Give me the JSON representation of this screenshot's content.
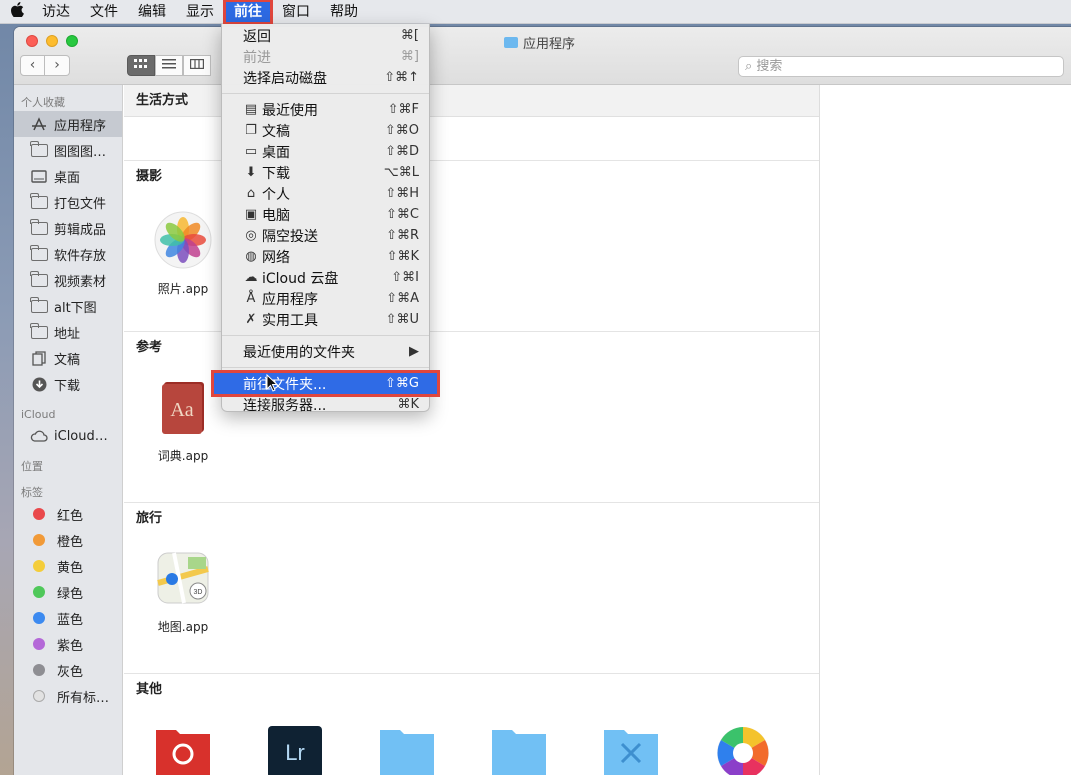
{
  "menubar": {
    "apple": "",
    "items": [
      "访达",
      "文件",
      "编辑",
      "显示",
      "前往",
      "窗口",
      "帮助"
    ]
  },
  "window": {
    "title": "应用程序",
    "search_placeholder": "搜索",
    "nav_back": "‹",
    "nav_forward": "›"
  },
  "sidebar": {
    "favorites_header": "个人收藏",
    "favorites": [
      "应用程序",
      "图图图…",
      "桌面",
      "打包文件",
      "剪辑成品",
      "软件存放",
      "视频素材",
      "alt下图",
      "地址",
      "文稿",
      "下载"
    ],
    "icloud_header": "iCloud",
    "icloud": [
      "iCloud…"
    ],
    "locations_header": "位置",
    "tags_header": "标签",
    "tags": [
      {
        "label": "红色",
        "color": "#e9484b"
      },
      {
        "label": "橙色",
        "color": "#f19a38"
      },
      {
        "label": "黄色",
        "color": "#f4cd3a"
      },
      {
        "label": "绿色",
        "color": "#4fc85a"
      },
      {
        "label": "蓝色",
        "color": "#3c8af0"
      },
      {
        "label": "紫色",
        "color": "#b468d8"
      },
      {
        "label": "灰色",
        "color": "#8e8e93"
      },
      {
        "label": "所有标…",
        "color": "#d8d8d8"
      }
    ]
  },
  "content": {
    "groups": {
      "lifestyle": "生活方式",
      "photo": "摄影",
      "reference": "参考",
      "travel": "旅行",
      "other": "其他"
    },
    "apps": {
      "photos": "照片.app",
      "dictionary": "词典.app",
      "maps": "地图.app"
    }
  },
  "go_menu": {
    "items": [
      {
        "label": "返回",
        "shortcut": "⌘[",
        "icon": "",
        "disabled": false
      },
      {
        "label": "前进",
        "shortcut": "⌘]",
        "icon": "",
        "disabled": true
      },
      {
        "label": "选择启动磁盘",
        "shortcut": "⇧⌘↑",
        "icon": "",
        "disabled": false
      },
      {
        "label": "最近使用",
        "shortcut": "⇧⌘F",
        "icon": "recents-icon"
      },
      {
        "label": "文稿",
        "shortcut": "⇧⌘O",
        "icon": "documents-icon"
      },
      {
        "label": "桌面",
        "shortcut": "⇧⌘D",
        "icon": "desktop-icon"
      },
      {
        "label": "下载",
        "shortcut": "⌥⌘L",
        "icon": "download-icon"
      },
      {
        "label": "个人",
        "shortcut": "⇧⌘H",
        "icon": "home-icon"
      },
      {
        "label": "电脑",
        "shortcut": "⇧⌘C",
        "icon": "computer-icon"
      },
      {
        "label": "隔空投送",
        "shortcut": "⇧⌘R",
        "icon": "airdrop-icon"
      },
      {
        "label": "网络",
        "shortcut": "⇧⌘K",
        "icon": "network-icon"
      },
      {
        "label": "iCloud 云盘",
        "shortcut": "⇧⌘I",
        "icon": "icloud-icon"
      },
      {
        "label": "应用程序",
        "shortcut": "⇧⌘A",
        "icon": "applications-icon"
      },
      {
        "label": "实用工具",
        "shortcut": "⇧⌘U",
        "icon": "utilities-icon"
      },
      {
        "label": "最近使用的文件夹",
        "shortcut": "▶"
      },
      {
        "label": "前往文件夹...",
        "shortcut": "⇧⌘G"
      },
      {
        "label": "连接服务器...",
        "shortcut": "⌘K"
      }
    ]
  },
  "colors": {
    "accent": "#2f6be6",
    "highlight_outline": "#e0463d"
  }
}
